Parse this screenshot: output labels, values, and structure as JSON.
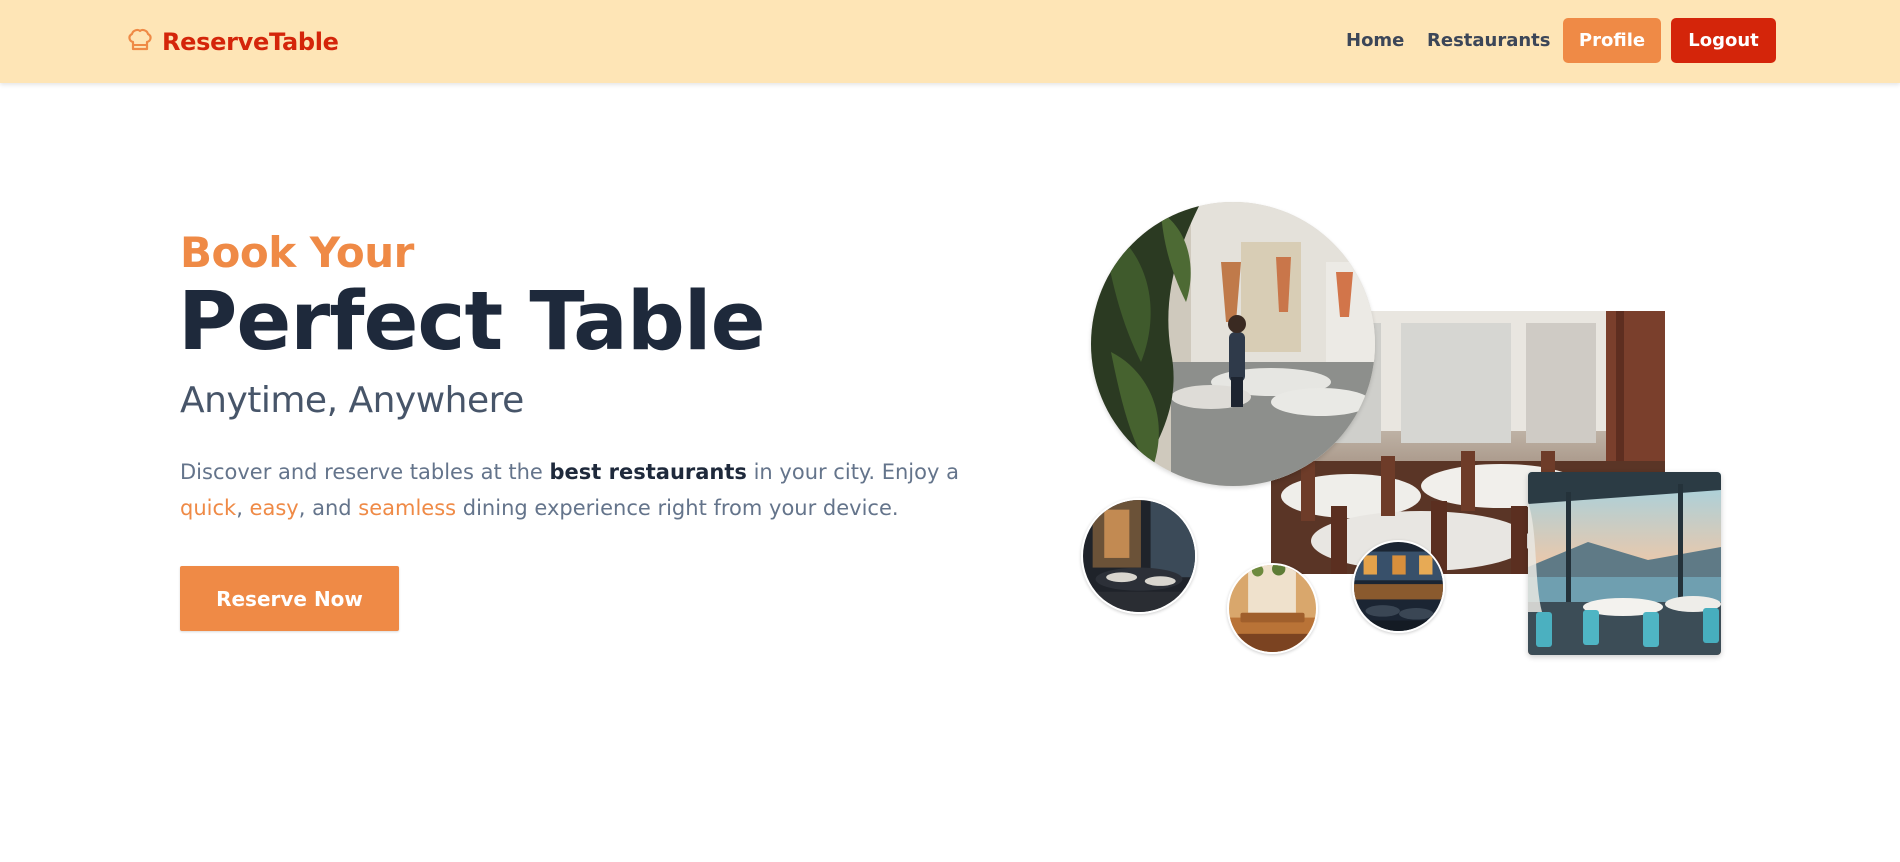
{
  "brand": {
    "name": "ReserveTable",
    "icon": "chef-hat-icon",
    "color": "#d4250a"
  },
  "nav": {
    "home": "Home",
    "restaurants": "Restaurants",
    "profile": "Profile",
    "logout": "Logout"
  },
  "hero": {
    "eyebrow": "Book Your",
    "headline": "Perfect Table",
    "subhead": "Anytime, Anywhere",
    "desc": {
      "p1": "Discover and reserve tables at the ",
      "strong": "best restaurants",
      "p2": " in your city. Enjoy a ",
      "w1": "quick",
      "sep1": ", ",
      "w2": "easy",
      "sep2": ", and ",
      "w3": "seamless",
      "p3": " dining experience right from your device."
    },
    "cta": "Reserve Now"
  },
  "colors": {
    "navbar_bg": "#fee5b6",
    "accent": "#ef8a46",
    "danger": "#d4250a",
    "heading": "#1e293b"
  }
}
